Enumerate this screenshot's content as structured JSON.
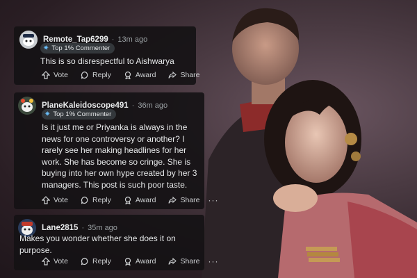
{
  "comments": [
    {
      "username": "Remote_Tap6299",
      "time": "13m ago",
      "badge": "Top 1% Commenter",
      "text": "This is so disrespectful to Aishwarya",
      "actions": {
        "vote": "Vote",
        "reply": "Reply",
        "award": "Award",
        "share": "Share"
      }
    },
    {
      "username": "PlaneKaleidoscope491",
      "time": "36m ago",
      "badge": "Top 1% Commenter",
      "text": "Is it just me or Priyanka is always in the news for one controversy or another? I rarely see her making headlines for her work. She has become so cringe. She is buying into her own hype created by her 3 managers. This post is such poor taste.",
      "actions": {
        "vote": "Vote",
        "reply": "Reply",
        "award": "Award",
        "share": "Share",
        "more": "···"
      }
    },
    {
      "username": "Lane2815",
      "time": "35m ago",
      "text": "Makes you wonder whether she does it on purpose.",
      "actions": {
        "vote": "Vote",
        "reply": "Reply",
        "award": "Award",
        "share": "Share",
        "more": "···"
      }
    }
  ],
  "icons": {
    "upvote": "upvote-arrow-icon",
    "reply": "speech-bubble-icon",
    "award": "award-icon",
    "share": "share-arrow-icon",
    "badge": "star-badge-icon"
  },
  "colors": {
    "card_bg": "#141214",
    "text": "#e6e8e9",
    "meta": "#9aa0a3",
    "badge_bg": "#33373b",
    "badge_star": "#6cc2ff"
  }
}
